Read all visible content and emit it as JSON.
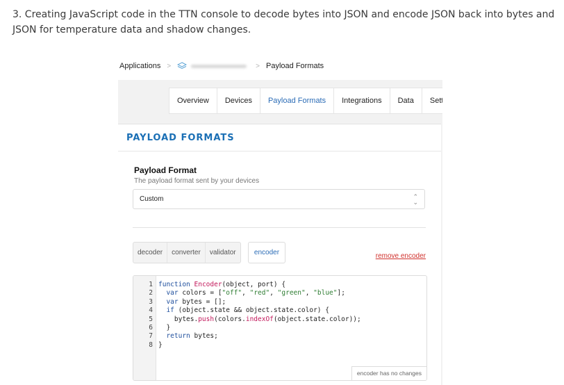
{
  "caption": "3. Creating JavaScript code in the TTN console to decode bytes into JSON and encode JSON back into bytes and JSON for temperature data and shadow changes.",
  "breadcrumb": {
    "applications": "Applications",
    "separator": ">",
    "current": "Payload Formats"
  },
  "tabs": [
    "Overview",
    "Devices",
    "Payload Formats",
    "Integrations",
    "Data",
    "Settings"
  ],
  "active_tab": "Payload Formats",
  "panel": {
    "title": "PAYLOAD FORMATS",
    "field_title": "Payload Format",
    "field_subtitle": "The payload format sent by your devices",
    "select_value": "Custom"
  },
  "format_buttons": [
    "decoder",
    "converter",
    "validator"
  ],
  "encoder_label": "encoder",
  "remove_label": "remove encoder",
  "editor": {
    "line_numbers": [
      "1",
      "2",
      "3",
      "4",
      "5",
      "6",
      "7",
      "8"
    ],
    "code_lines": [
      "function Encoder(object, port) {",
      "  var colors = [\"off\", \"red\", \"green\", \"blue\"];",
      "  var bytes = [];",
      "  if (object.state && object.state.color) {",
      "    bytes.push(colors.indexOf(object.state.color));",
      "  }",
      "  return bytes;",
      "}"
    ],
    "status": "encoder has no changes"
  },
  "colors": {
    "accent": "#1a6fb5",
    "active_tab": "#2b6cb6",
    "danger_link": "#d0312d",
    "code_keyword": "#1e4e9c",
    "code_function": "#c2185b",
    "code_string": "#2e7d32"
  },
  "icons": {
    "app_icon": "stack-layers-icon",
    "select_chevron": "updown-chevron-icon"
  }
}
